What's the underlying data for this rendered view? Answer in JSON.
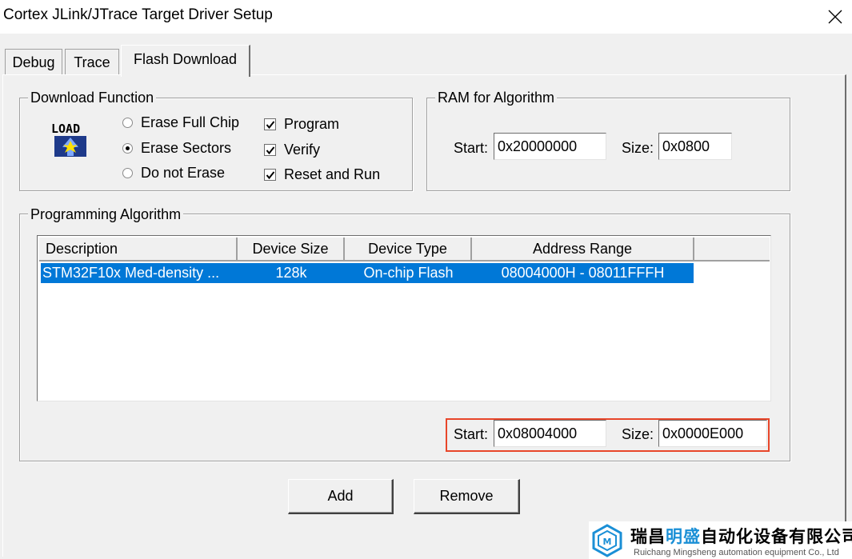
{
  "window": {
    "title": "Cortex JLink/JTrace Target Driver Setup"
  },
  "tabs": [
    {
      "label": "Debug"
    },
    {
      "label": "Trace"
    },
    {
      "label": "Flash Download"
    }
  ],
  "download_function": {
    "title": "Download Function",
    "icon": "load-icon",
    "radios": [
      {
        "label": "Erase Full Chip",
        "checked": false
      },
      {
        "label": "Erase Sectors",
        "checked": true
      },
      {
        "label": "Do not Erase",
        "checked": false
      }
    ],
    "checks": [
      {
        "label": "Program",
        "checked": true
      },
      {
        "label": "Verify",
        "checked": true
      },
      {
        "label": "Reset and Run",
        "checked": true
      }
    ]
  },
  "ram": {
    "title": "RAM for Algorithm",
    "start_label": "Start:",
    "start_value": "0x20000000",
    "size_label": "Size:",
    "size_value": "0x0800"
  },
  "programming_algorithm": {
    "title": "Programming Algorithm",
    "columns": [
      "Description",
      "Device Size",
      "Device Type",
      "Address Range"
    ],
    "rows": [
      {
        "description": "STM32F10x Med-density ...",
        "size": "128k",
        "type": "On-chip Flash",
        "range": "08004000H - 08011FFFH",
        "selected": true
      }
    ],
    "start_label": "Start:",
    "start_value": "0x08004000",
    "size_label": "Size:",
    "size_value": "0x0000E000"
  },
  "buttons": {
    "add": "Add",
    "remove": "Remove"
  },
  "watermark": {
    "cn_prefix": "瑞昌",
    "cn_highlight": "明盛",
    "cn_suffix": "自动化设备有限公司",
    "en": "Ruichang Mingsheng automation equipment Co., Ltd",
    "colors": {
      "highlight": "#1a8fd6"
    }
  },
  "colors": {
    "selection": "#0078d7",
    "highlight_box": "#e8462a",
    "face": "#f0f0f0"
  }
}
